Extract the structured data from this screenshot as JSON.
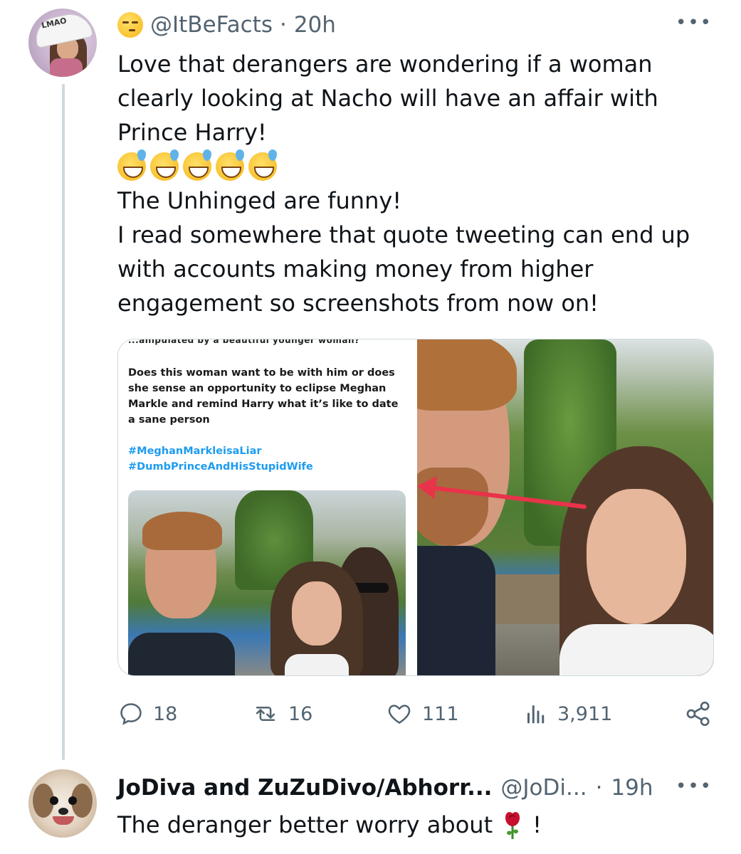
{
  "tweet": {
    "handle": "@ItBeFacts",
    "separator": "·",
    "time": "20h",
    "more_icon": "more-horizontal-icon",
    "avatar_cap_text": "LMAO",
    "text_lines": [
      "Love that derangers are wondering if a woman",
      "clearly looking at Nacho will have an affair with",
      "Prince Harry!"
    ],
    "emoji_count": 5,
    "text_lines_after": [
      "The Unhinged are funny!",
      "I read somewhere that quote tweeting can end up",
      "with accounts making money from higher",
      "engagement so screenshots from now on!"
    ],
    "media": {
      "left_cut_text": "...anipulated by a beautiful younger woman?",
      "left_body": "Does this woman want to be with him or does she sense an opportunity to eclipse Meghan Markle and remind Harry what it’s like to date a sane person",
      "hashtag1": "#MeghanMarkleisaLiar",
      "hashtag2": "#DumbPrinceAndHisStupidWife"
    },
    "actions": {
      "replies": "18",
      "reposts": "16",
      "likes": "111",
      "views": "3,911"
    }
  },
  "reply": {
    "name": "JoDiva and ZuZuDivo/Abhorr...",
    "handle": "@JoDi...",
    "separator": "·",
    "time": "19h",
    "text_before": "The deranger better worry about",
    "text_after": "!"
  },
  "colors": {
    "secondary_text": "#536471",
    "primary_text": "#0f1419",
    "link": "#1d9bf0",
    "border": "#cfd9de",
    "arrow": "#e8334a"
  }
}
